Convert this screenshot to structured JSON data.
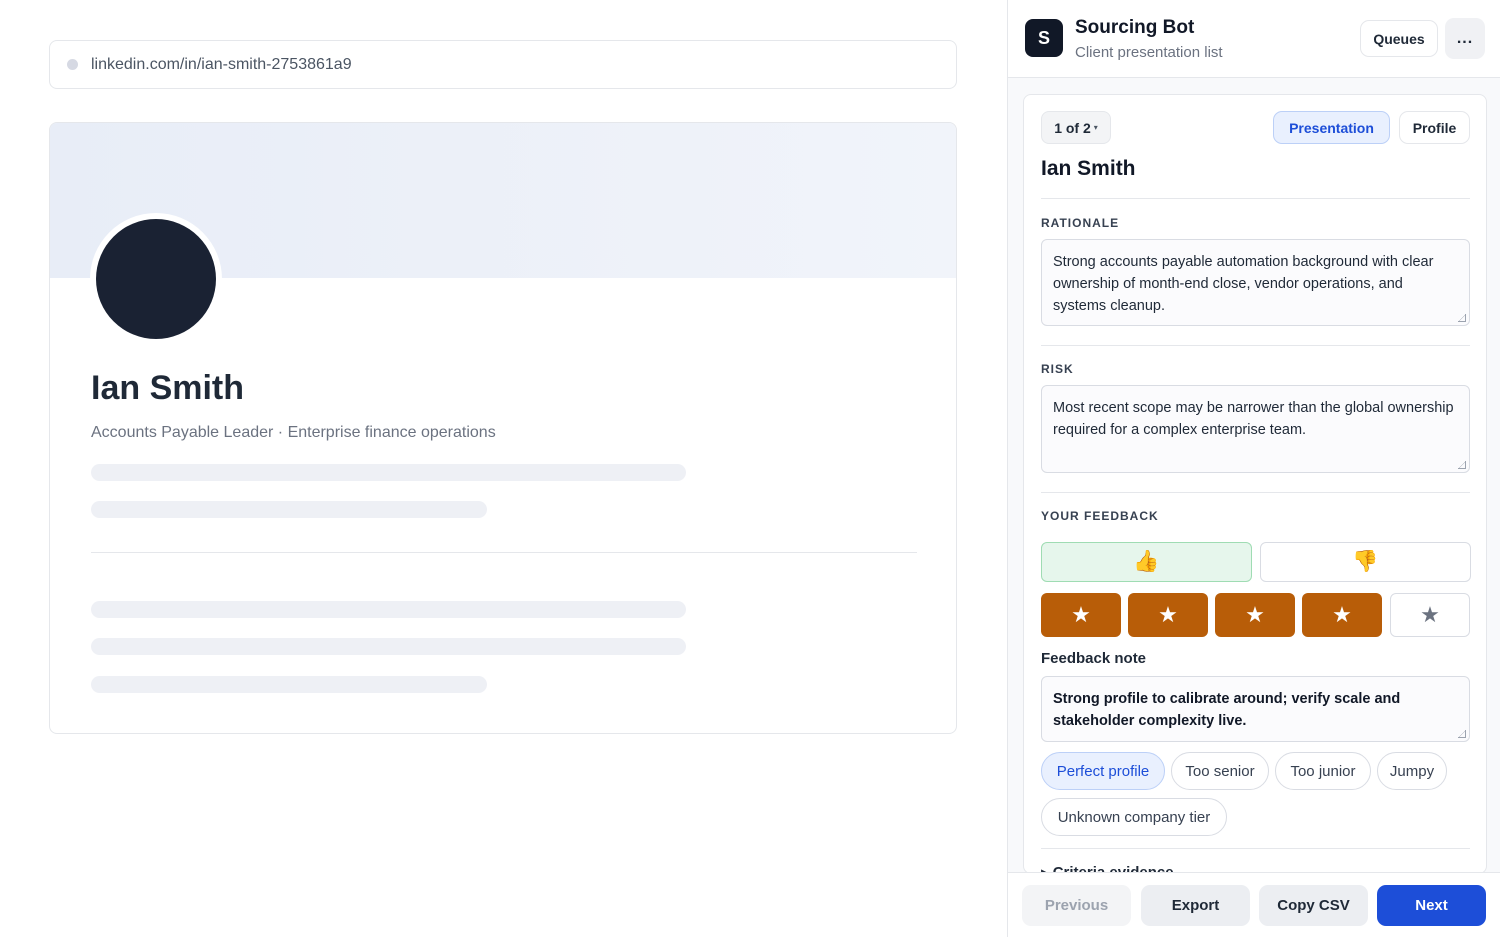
{
  "url_bar": {
    "url": "linkedin.com/in/ian-smith-2753861a9"
  },
  "profile": {
    "name": "Ian Smith",
    "headline": "Accounts Payable Leader · Enterprise finance operations"
  },
  "panel": {
    "app_title": "Sourcing Bot",
    "app_subtitle": "Client presentation list",
    "logo_letter": "S",
    "queues_label": "Queues",
    "more_label": "...",
    "pager_label": "1 of 2",
    "pager_caret": "▾",
    "tabs": {
      "presentation": "Presentation",
      "profile": "Profile"
    },
    "candidate_name": "Ian Smith",
    "rationale_label": "RATIONALE",
    "rationale_text": "Strong accounts payable automation background with clear ownership of month-end close, vendor operations, and systems cleanup.",
    "risk_label": "RISK",
    "risk_text": "Most recent scope may be narrower than the global ownership required for a complex enterprise team.",
    "feedback_label": "YOUR FEEDBACK",
    "thumbs_up_glyph": "👍",
    "thumbs_down_glyph": "👎",
    "star_glyph": "★",
    "rating": 4,
    "rating_max": 5,
    "feedback_note_label": "Feedback note",
    "feedback_note_text": "Strong profile to calibrate around; verify scale and stakeholder complexity live.",
    "chips": [
      "Perfect profile",
      "Too senior",
      "Too junior",
      "Jumpy",
      "Unknown company tier"
    ],
    "selected_chip": "Perfect profile",
    "criteria_label": "Criteria evidence",
    "criteria_arrow": "▸",
    "footer": {
      "previous": "Previous",
      "export": "Export",
      "copy_csv": "Copy CSV",
      "next": "Next"
    }
  },
  "colors": {
    "accent": "#1d4ed8",
    "star_on": "#b85d08",
    "thumb_up_bg": "#e6f6ec"
  }
}
